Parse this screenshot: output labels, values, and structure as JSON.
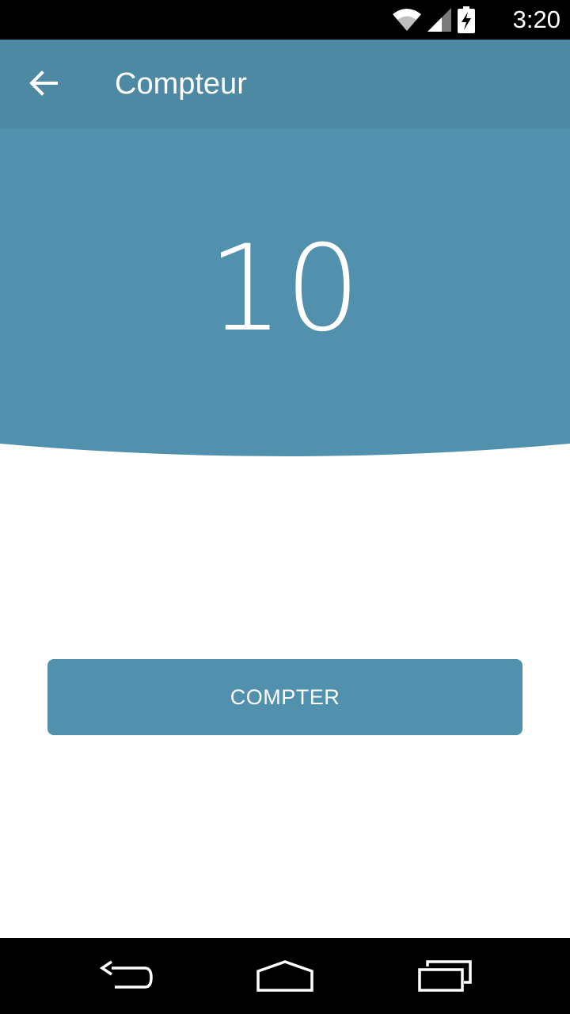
{
  "status_bar": {
    "time": "3:20",
    "icons": [
      "wifi-icon",
      "cell-signal-icon",
      "battery-charging-icon"
    ]
  },
  "app_bar": {
    "title": "Compteur",
    "back_icon": "arrow-back-icon"
  },
  "counter": {
    "value": "10"
  },
  "actions": {
    "count_button_label": "COMPTER"
  },
  "nav_bar": {
    "icons": [
      "back-nav-icon",
      "home-nav-icon",
      "recents-nav-icon"
    ]
  },
  "colors": {
    "app_bar": "#4e89a3",
    "header": "#5291ae",
    "button": "#5291ae",
    "background": "#ffffff",
    "system_bars": "#000000"
  }
}
